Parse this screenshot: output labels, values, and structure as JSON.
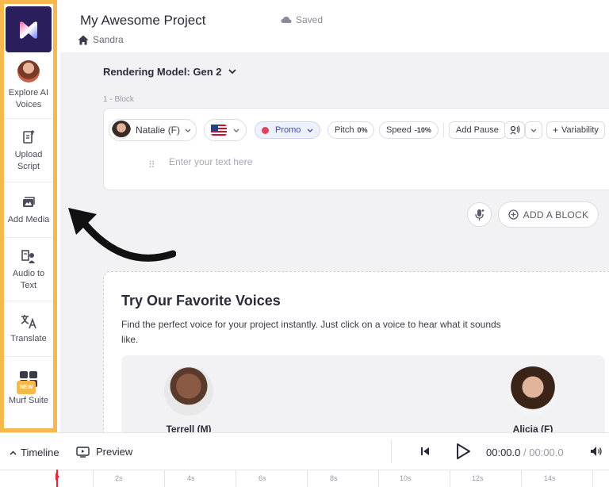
{
  "header": {
    "project_title": "My Awesome Project",
    "saved_status": "Saved",
    "breadcrumb": "Sandra"
  },
  "sidebar": {
    "items": [
      {
        "label": "Explore AI Voices",
        "icon": "avatar"
      },
      {
        "label": "Upload Script",
        "icon": "upload-script-icon"
      },
      {
        "label": "Add Media",
        "icon": "media-icon"
      },
      {
        "label": "Audio to Text",
        "icon": "audio-to-text-icon"
      },
      {
        "label": "Translate",
        "icon": "translate-icon"
      },
      {
        "label": "Murf Suite",
        "icon": "grid-icon",
        "badge": "NEW"
      }
    ]
  },
  "editor": {
    "rendering_model": "Rendering Model: Gen 2",
    "block_label": "1 -  Block",
    "voice_name": "Natalie (F)",
    "style": "Promo",
    "pitch_label": "Pitch",
    "pitch_value": "0%",
    "speed_label": "Speed",
    "speed_value": "-10%",
    "add_pause": "Add Pause",
    "variability": "Variability",
    "text_placeholder": "Enter your text here",
    "add_block": "ADD A BLOCK"
  },
  "favorites": {
    "title": "Try Our Favorite Voices",
    "subtitle": "Find the perfect voice for your project instantly. Just click on a voice to hear what it sounds like.",
    "voices": [
      {
        "name": "Terrell (M)"
      },
      {
        "name": "Alicia (F)"
      }
    ]
  },
  "player": {
    "timeline_label": "Timeline",
    "preview_label": "Preview",
    "current_time": "00:00.0",
    "separator": " / ",
    "duration": "00:00.0"
  },
  "ruler": {
    "labels": [
      "2s",
      "4s",
      "6s",
      "8s",
      "10s",
      "12s",
      "14s"
    ]
  },
  "colors": {
    "sidebar_highlight": "#f8b84e",
    "logo_bg": "#2a1f5c",
    "playhead": "#e02a3c",
    "promo_accent": "#3a4ab0"
  }
}
